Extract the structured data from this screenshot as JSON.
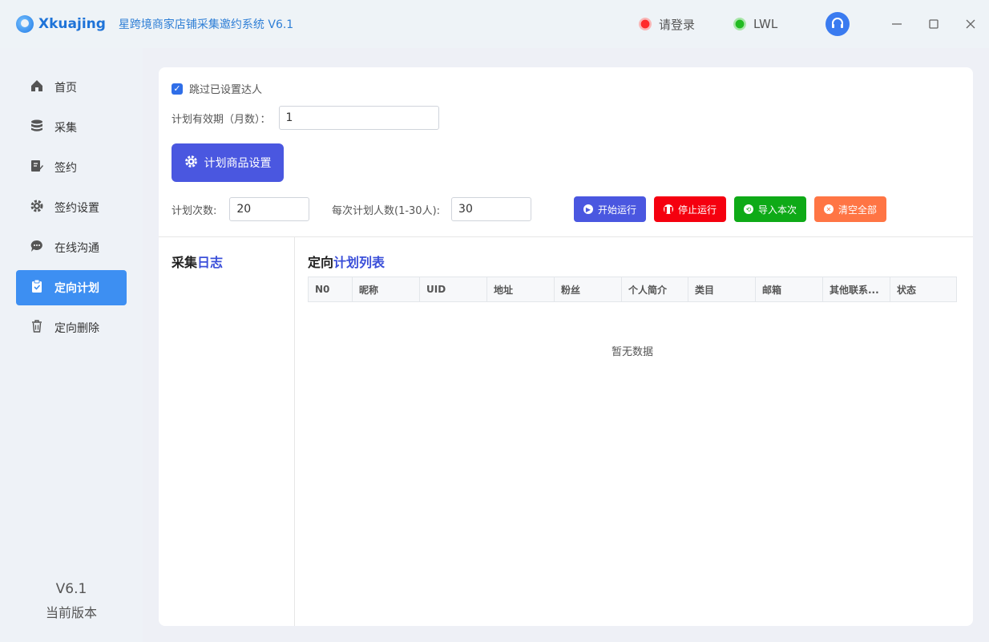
{
  "app": {
    "logo_text": "Xkuajing",
    "title": "星跨境商家店铺采集邀约系统 V6.1"
  },
  "header": {
    "login_status": "请登录",
    "user_status": "LWL"
  },
  "sidebar": {
    "items": [
      {
        "label": "首页",
        "icon": "home-icon"
      },
      {
        "label": "采集",
        "icon": "database-icon"
      },
      {
        "label": "签约",
        "icon": "edit-doc-icon"
      },
      {
        "label": "签约设置",
        "icon": "gear-icon"
      },
      {
        "label": "在线沟通",
        "icon": "chat-icon"
      },
      {
        "label": "定向计划",
        "icon": "clipboard-check-icon",
        "active": true
      },
      {
        "label": "定向删除",
        "icon": "trash-icon"
      }
    ],
    "version": "V6.1",
    "version_label": "当前版本"
  },
  "form": {
    "skip_label": "跳过已设置达人",
    "skip_checked": true,
    "validity_label": "计划有效期（月数）：",
    "validity_value": "1",
    "plan_goods_button": "计划商品设置",
    "plan_count_label": "计划次数:",
    "plan_count_value": "20",
    "per_plan_label": "每次计划人数(1-30人):",
    "per_plan_value": "30"
  },
  "actions": {
    "start": "开始运行",
    "stop": "停止运行",
    "import": "导入本次",
    "clear": "清空全部"
  },
  "log": {
    "title_a": "采集",
    "title_b": "日志"
  },
  "plan_list": {
    "title_a": "定向",
    "title_b": "计划列表",
    "columns": [
      "N0",
      "昵称",
      "UID",
      "地址",
      "粉丝",
      "个人简介",
      "类目",
      "邮箱",
      "其他联系...",
      "状态"
    ],
    "empty_text": "暂无数据"
  },
  "colors": {
    "primary": "#4a57e0",
    "danger": "#f5000f",
    "success": "#0eaa17",
    "warning": "#ff7544",
    "active_nav": "#3d8ff2"
  }
}
